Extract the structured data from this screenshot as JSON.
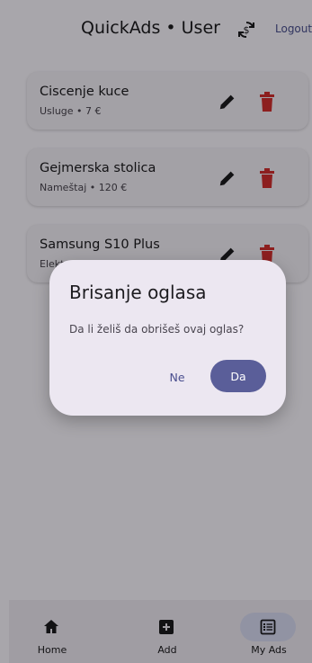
{
  "appbar": {
    "title": "QuickAds • User",
    "logout_label": "Logout"
  },
  "ads": [
    {
      "title": "Ciscenje kuce",
      "subtitle": "Usluge • 7 €"
    },
    {
      "title": "Gejmerska stolica",
      "subtitle": "Nameštaj • 120 €"
    },
    {
      "title": "Samsung S10 Plus",
      "subtitle": "Elektronika"
    }
  ],
  "dialog": {
    "title": "Brisanje oglasa",
    "message": "Da li želiš da obrišeš ovaj oglas?",
    "no_label": "Ne",
    "yes_label": "Da"
  },
  "nav": {
    "items": [
      {
        "label": "Home",
        "icon": "home-icon"
      },
      {
        "label": "Add",
        "icon": "add-box-icon"
      },
      {
        "label": "My Ads",
        "icon": "list-alt-icon",
        "active": true
      }
    ]
  },
  "colors": {
    "accent": "#5a5e99",
    "delete": "#d32f2f",
    "surface": "#fbf8ff",
    "dialog_bg": "#ece7f1"
  }
}
